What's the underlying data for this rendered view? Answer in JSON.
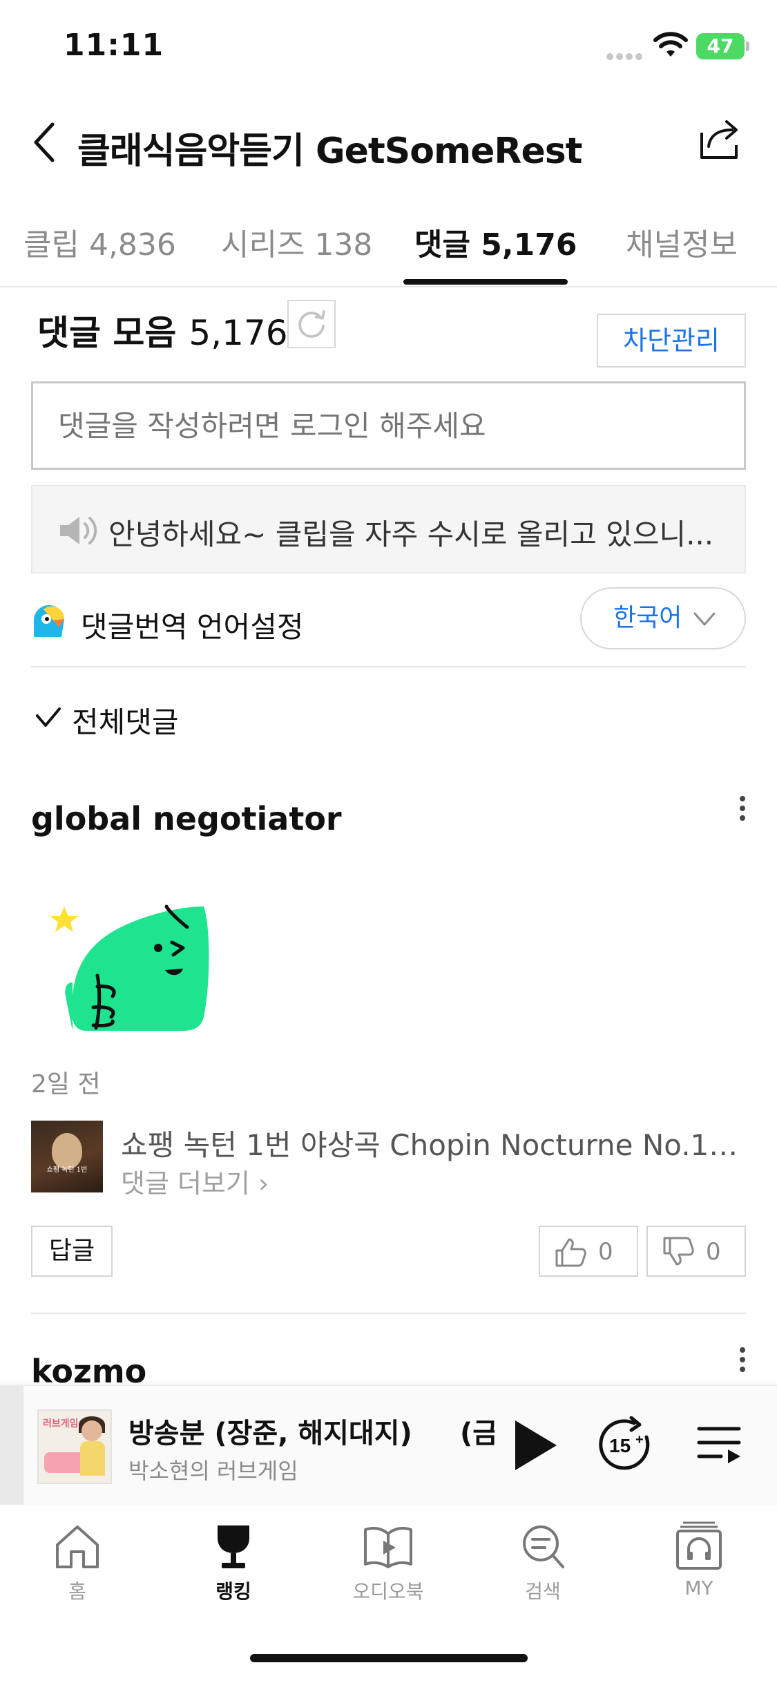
{
  "status_bar": {
    "time": "11:11",
    "battery": "47"
  },
  "header": {
    "title": "클래식음악듣기 GetSomeRest"
  },
  "tabs": [
    {
      "label": "클립 4,836"
    },
    {
      "label": "시리즈 138"
    },
    {
      "label": "댓글 5,176"
    },
    {
      "label": "채널정보"
    }
  ],
  "comments": {
    "title": "댓글 모음",
    "count": "5,176",
    "block_label": "차단관리",
    "input_placeholder": "댓글을 작성하려면 로그인 해주세요",
    "notice": "안녕하세요~ 클립을 자주 수시로 올리고 있으니...",
    "translate_label": "댓글번역 언어설정",
    "language": "한국어",
    "filter": "전체댓글"
  },
  "comment_list": [
    {
      "user": "global negotiator",
      "time_ago": "2일 전",
      "clip_title": "쇼팽 녹턴 1번 야상곡 Chopin Nocturne No.1 ...",
      "clip_thumb_caption": "쇼팽 녹턴 1번",
      "more_replies": "댓글 더보기",
      "reply_label": "답글",
      "likes": "0",
      "dislikes": "0"
    },
    {
      "user": "kozmo"
    }
  ],
  "player": {
    "title": "방송분 (장준, 해지대지)",
    "title_overflow": "(금",
    "subtitle": "박소현의 러브게임",
    "thumb_tag": "러브게임"
  },
  "tabbar": [
    {
      "label": "홈",
      "icon": "home-icon"
    },
    {
      "label": "랭킹",
      "icon": "trophy-icon"
    },
    {
      "label": "오디오북",
      "icon": "book-icon"
    },
    {
      "label": "검색",
      "icon": "search-icon"
    },
    {
      "label": "MY",
      "icon": "headphones-icon"
    }
  ],
  "colors": {
    "accent_blue": "#1a73e8",
    "sticker_green": "#1ee38f",
    "battery_green": "#4cd964"
  }
}
